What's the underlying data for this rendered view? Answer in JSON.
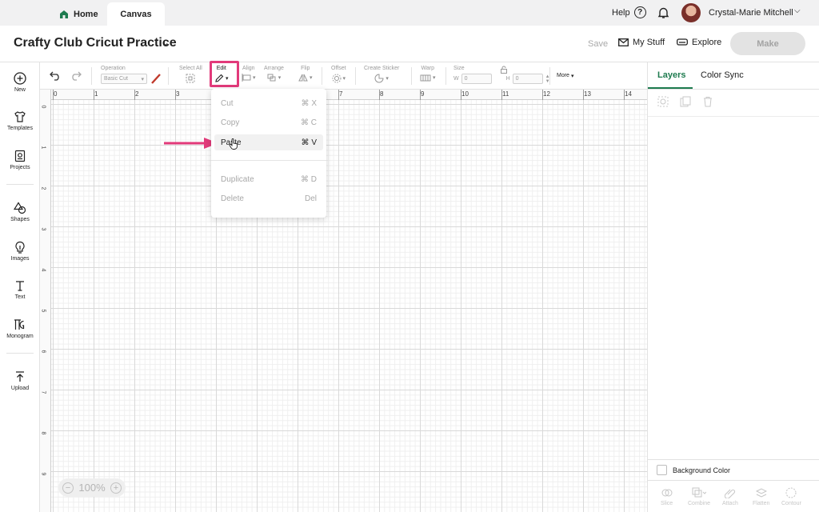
{
  "topbar": {
    "home_label": "Home",
    "canvas_label": "Canvas",
    "help_label": "Help",
    "user_name": "Crystal-Marie Mitchell"
  },
  "project": {
    "title": "Crafty Club Cricut Practice",
    "save_label": "Save",
    "my_stuff_label": "My Stuff",
    "explore_label": "Explore",
    "make_label": "Make"
  },
  "sidebar": {
    "items": [
      {
        "label": "New",
        "icon": "plus-circle-icon"
      },
      {
        "label": "Templates",
        "icon": "shirt-icon"
      },
      {
        "label": "Projects",
        "icon": "projects-icon"
      },
      {
        "label": "Shapes",
        "icon": "shapes-icon"
      },
      {
        "label": "Images",
        "icon": "bulb-icon"
      },
      {
        "label": "Text",
        "icon": "text-icon"
      },
      {
        "label": "Monogram",
        "icon": "monogram-icon"
      },
      {
        "label": "Upload",
        "icon": "upload-icon"
      }
    ]
  },
  "toolbar": {
    "operation_label": "Operation",
    "operation_value": "Basic Cut",
    "select_all_label": "Select All",
    "edit_label": "Edit",
    "align_label": "Align",
    "arrange_label": "Arrange",
    "flip_label": "Flip",
    "offset_label": "Offset",
    "create_sticker_label": "Create Sticker",
    "warp_label": "Warp",
    "size_label": "Size",
    "w_label": "W",
    "w_value": "0",
    "h_label": "H",
    "h_value": "0",
    "more_label": "More"
  },
  "ruler": {
    "top": [
      "0",
      "1",
      "2",
      "3",
      "4",
      "5",
      "6",
      "7",
      "8",
      "9",
      "10",
      "11",
      "12",
      "13",
      "14"
    ],
    "left": [
      "0",
      "1",
      "2",
      "3",
      "4",
      "5",
      "6",
      "7",
      "8",
      "9"
    ]
  },
  "edit_menu": {
    "items": [
      {
        "label": "Cut",
        "shortcut": "⌘ X"
      },
      {
        "label": "Copy",
        "shortcut": "⌘ C"
      },
      {
        "label": "Paste",
        "shortcut": "⌘ V"
      },
      {
        "label": "Duplicate",
        "shortcut": "⌘ D"
      },
      {
        "label": "Delete",
        "shortcut": "Del"
      }
    ],
    "highlighted": "Paste"
  },
  "zoom": {
    "value": "100%"
  },
  "right_panel": {
    "tab_layers": "Layers",
    "tab_color_sync": "Color Sync",
    "background_color_label": "Background Color",
    "bottom_actions": [
      "Slice",
      "Combine",
      "Attach",
      "Flatten",
      "Contour"
    ]
  },
  "colors": {
    "accent_green": "#1e7b4f",
    "highlight_pink": "#e23a7a"
  }
}
